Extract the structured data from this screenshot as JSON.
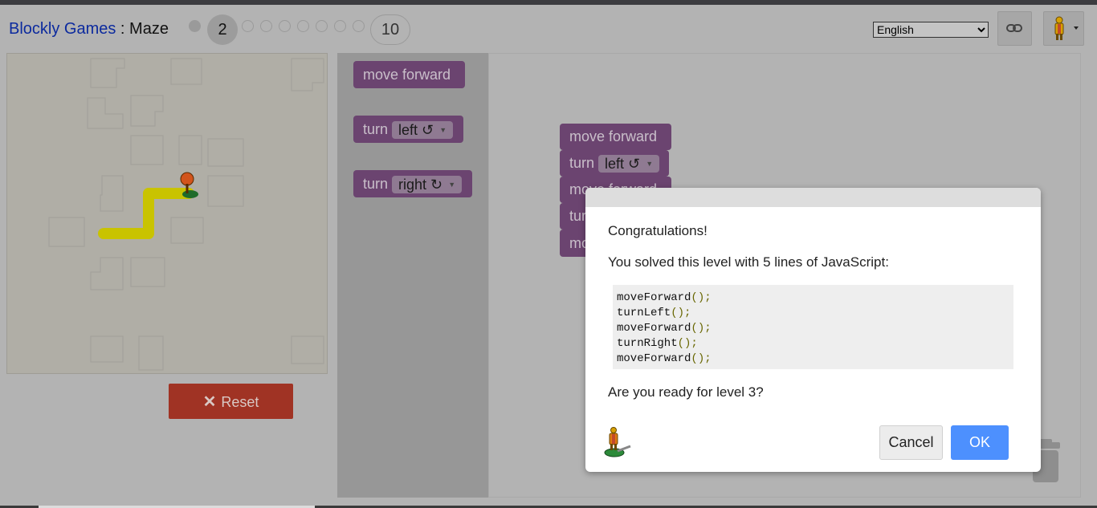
{
  "header": {
    "app_name": "Blockly Games",
    "separator": " : ",
    "game_name": "Maze",
    "current_level": "2",
    "last_level": "10",
    "language_selected": "English"
  },
  "maze": {
    "reset_label": "Reset"
  },
  "toolbox": {
    "move_forward": "move forward",
    "turn_label": "turn",
    "left_option": "left ↺",
    "right_option": "right ↻"
  },
  "workspace": {
    "block1": "move forward",
    "block2_turn": "turn",
    "block2_dir": "left ↺",
    "block3": "move forward",
    "block4": "turn",
    "block5": "move"
  },
  "dialog": {
    "line1": "Congratulations!",
    "line2": "You solved this level with 5 lines of JavaScript:",
    "code": [
      {
        "fn": "moveForward",
        "args": "();"
      },
      {
        "fn": "turnLeft",
        "args": "();"
      },
      {
        "fn": "moveForward",
        "args": "();"
      },
      {
        "fn": "turnRight",
        "args": "();"
      },
      {
        "fn": "moveForward",
        "args": "();"
      }
    ],
    "line3": "Are you ready for level 3?",
    "cancel_label": "Cancel",
    "ok_label": "OK"
  },
  "colors": {
    "accent_blue": "#4d90fe",
    "reset_red": "#a03324",
    "block_purple": "#6b4470",
    "path_yellow": "#c9c300"
  }
}
